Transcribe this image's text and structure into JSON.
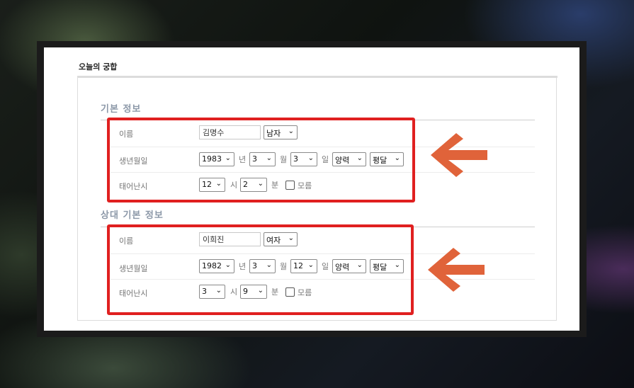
{
  "page": {
    "title": "오늘의 궁합"
  },
  "colors": {
    "highlight": "#e02020",
    "arrow": "#e0633a",
    "section_title": "#8c98a8"
  },
  "self": {
    "section_title": "기본 정보",
    "name_label": "이름",
    "name_value": "김명수",
    "gender": "남자",
    "birth_label": "생년월일",
    "year": "1983",
    "year_unit": "년",
    "month": "3",
    "month_unit": "월",
    "day": "3",
    "day_unit": "일",
    "calendar": "양력",
    "leap": "평달",
    "time_label": "태어난시",
    "hour": "12",
    "hour_unit": "시",
    "minute": "2",
    "minute_unit": "분",
    "unknown_label": "모름",
    "unknown_checked": false
  },
  "partner": {
    "section_title": "상대 기본 정보",
    "name_label": "이름",
    "name_value": "이희진",
    "gender": "여자",
    "birth_label": "생년월일",
    "year": "1982",
    "year_unit": "년",
    "month": "3",
    "month_unit": "월",
    "day": "12",
    "day_unit": "일",
    "calendar": "양력",
    "leap": "평달",
    "time_label": "태어난시",
    "hour": "3",
    "hour_unit": "시",
    "minute": "9",
    "minute_unit": "분",
    "unknown_label": "모름",
    "unknown_checked": false
  },
  "icons": {
    "select_chevron": "chevron-down-icon",
    "arrow": "arrow-left-icon"
  }
}
